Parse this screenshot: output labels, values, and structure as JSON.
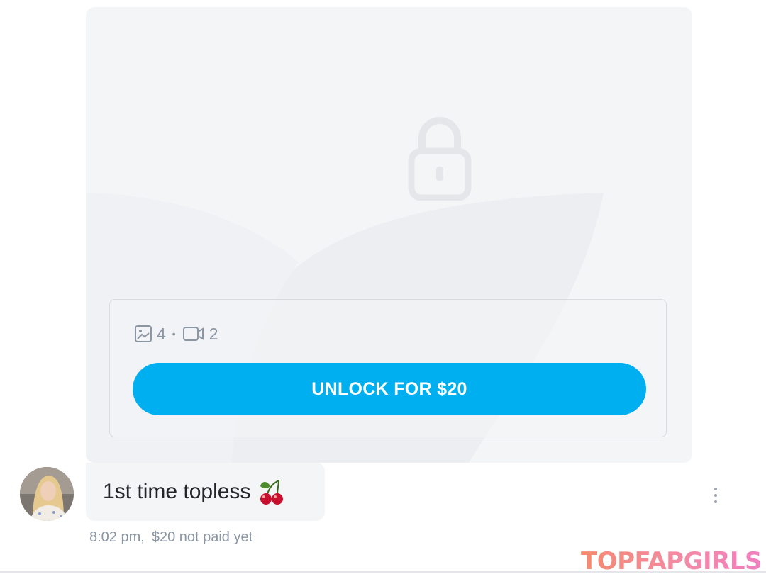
{
  "locked_post": {
    "photo_count": "4",
    "separator": "•",
    "video_count": "2",
    "unlock_label": "UNLOCK FOR $20"
  },
  "message": {
    "text": "1st time topless",
    "time": "8:02 pm,",
    "payment_status": "$20 not paid yet"
  },
  "icons": {
    "lock": "lock-icon",
    "photo": "image-icon",
    "video": "video-icon",
    "emoji": "cherries-emoji",
    "more": "more-vertical-icon"
  },
  "colors": {
    "accent": "#00aff0",
    "card_bg": "#f4f5f7",
    "muted_text": "#8a96a3"
  },
  "watermark": {
    "text": "TOPFAPGIRLS"
  }
}
